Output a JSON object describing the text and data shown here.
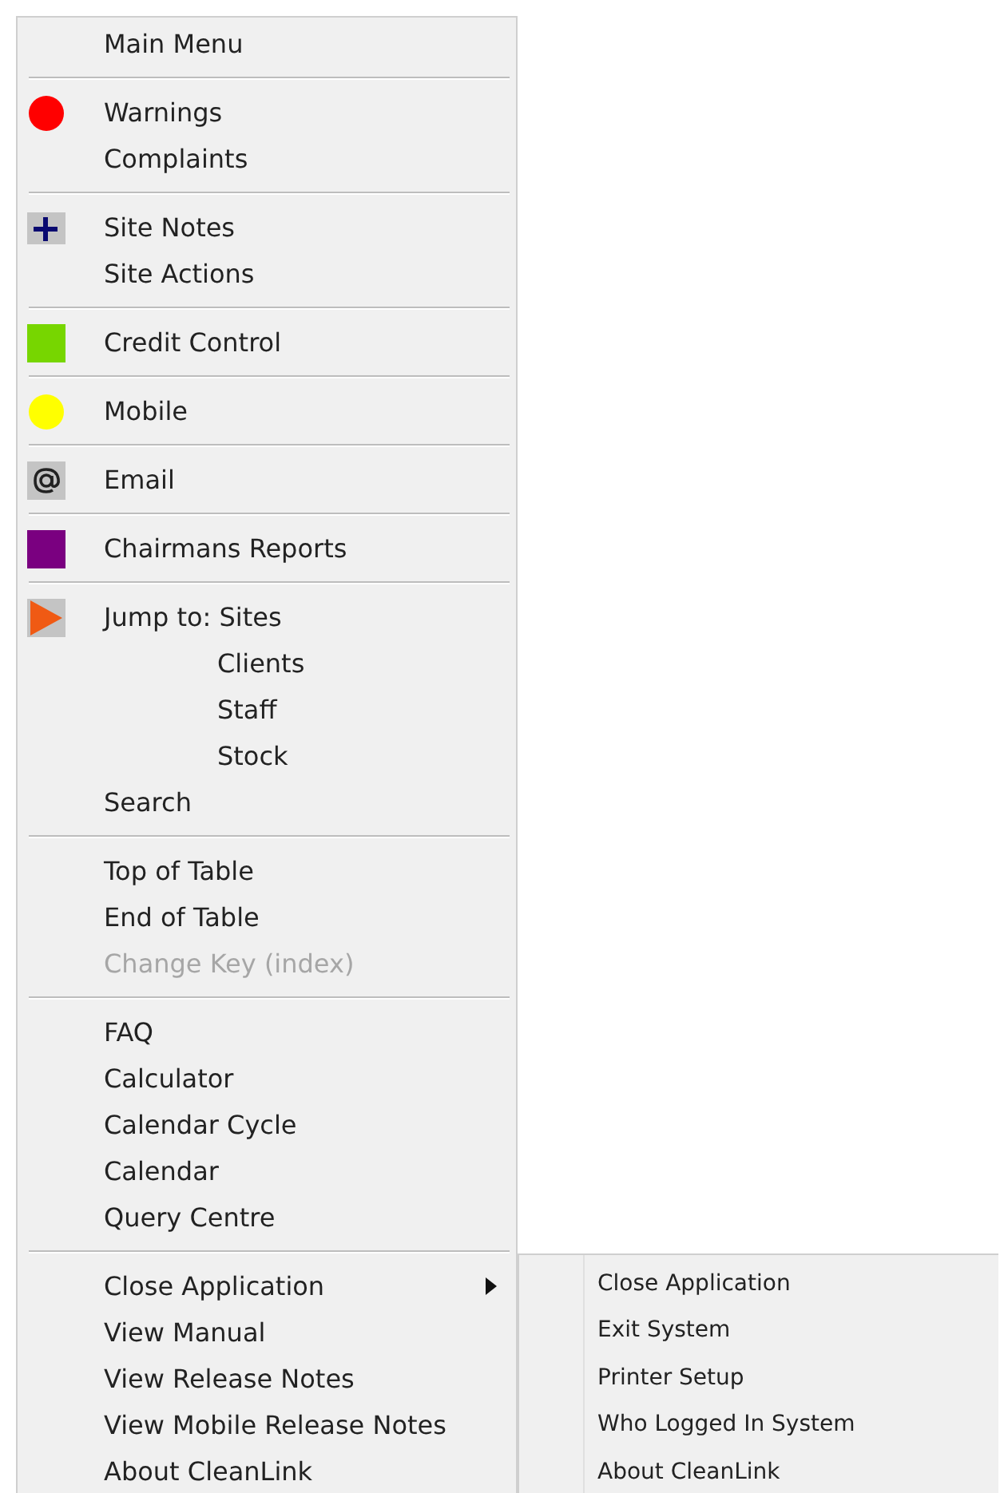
{
  "menu": {
    "groups": [
      {
        "items": [
          {
            "label": "Main Menu",
            "kind": "item",
            "disabled": false
          }
        ]
      },
      {
        "items": [
          {
            "label": "Warnings",
            "kind": "dot",
            "disabled": false,
            "color": "#ff0000"
          },
          {
            "label": "Complaints",
            "kind": "item",
            "disabled": false
          }
        ]
      },
      {
        "items": [
          {
            "label": "Site Notes",
            "kind": "plus",
            "disabled": false
          },
          {
            "label": "Site Actions",
            "kind": "item",
            "disabled": false
          }
        ]
      },
      {
        "items": [
          {
            "label": "Credit Control",
            "kind": "square",
            "disabled": false,
            "color": "#77d600"
          }
        ]
      },
      {
        "items": [
          {
            "label": "Mobile",
            "kind": "dot",
            "disabled": false,
            "color": "#ffff00"
          }
        ]
      },
      {
        "items": [
          {
            "label": "Email",
            "kind": "at",
            "disabled": false
          }
        ]
      },
      {
        "items": [
          {
            "label": "Chairmans Reports",
            "kind": "square",
            "disabled": false,
            "color": "#7a0080"
          }
        ]
      },
      {
        "items": [
          {
            "label": "Jump to: Sites",
            "kind": "play",
            "disabled": false
          },
          {
            "label": "Clients",
            "kind": "subitem",
            "disabled": false
          },
          {
            "label": "Staff",
            "kind": "subitem",
            "disabled": false
          },
          {
            "label": "Stock",
            "kind": "subitem",
            "disabled": false
          },
          {
            "label": "Search",
            "kind": "item",
            "disabled": false
          }
        ]
      },
      {
        "items": [
          {
            "label": "Top of Table",
            "kind": "item",
            "disabled": false
          },
          {
            "label": "End of Table",
            "kind": "item",
            "disabled": false
          },
          {
            "label": "Change Key (index)",
            "kind": "item",
            "disabled": true
          }
        ]
      },
      {
        "items": [
          {
            "label": "FAQ",
            "kind": "item",
            "disabled": false
          },
          {
            "label": "Calculator",
            "kind": "item",
            "disabled": false
          },
          {
            "label": "Calendar Cycle",
            "kind": "item",
            "disabled": false
          },
          {
            "label": "Calendar",
            "kind": "item",
            "disabled": false
          },
          {
            "label": "Query Centre",
            "kind": "item",
            "disabled": false
          }
        ]
      },
      {
        "items": [
          {
            "label": "Close Application",
            "kind": "item",
            "disabled": false,
            "submenu": [
              "Close Application",
              "Exit System",
              "Printer Setup",
              "Who Logged In System",
              "About CleanLink"
            ]
          },
          {
            "label": "View Manual",
            "kind": "item",
            "disabled": false
          },
          {
            "label": "View Release Notes",
            "kind": "item",
            "disabled": false
          },
          {
            "label": "View Mobile Release Notes",
            "kind": "item",
            "disabled": false
          },
          {
            "label": "About CleanLink",
            "kind": "item",
            "disabled": false
          }
        ]
      }
    ]
  }
}
